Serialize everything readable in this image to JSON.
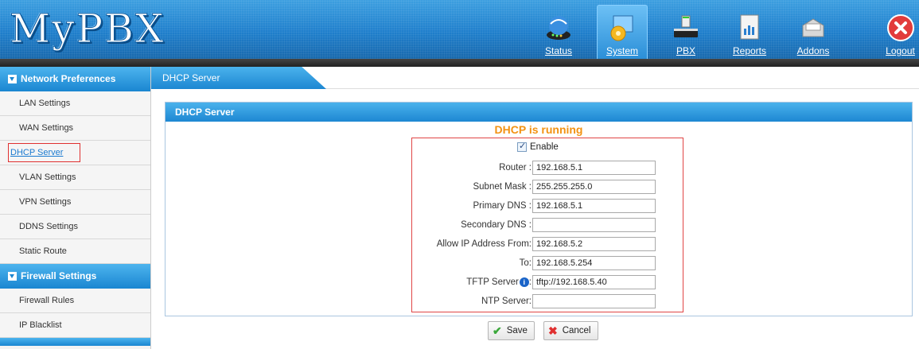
{
  "header": {
    "logo": "MyPBX",
    "nav": [
      {
        "label": "Status",
        "icon": "status-icon"
      },
      {
        "label": "System",
        "icon": "system-icon",
        "active": true
      },
      {
        "label": "PBX",
        "icon": "pbx-icon"
      },
      {
        "label": "Reports",
        "icon": "reports-icon"
      },
      {
        "label": "Addons",
        "icon": "addons-icon"
      }
    ],
    "logout_label": "Logout"
  },
  "sidebar": {
    "sections": [
      {
        "title": "Network Preferences",
        "items": [
          "LAN Settings",
          "WAN Settings",
          "DHCP Server",
          "VLAN Settings",
          "VPN Settings",
          "DDNS Settings",
          "Static Route"
        ]
      },
      {
        "title": "Firewall Settings",
        "items": [
          "Firewall Rules",
          "IP Blacklist"
        ]
      }
    ],
    "selected": "DHCP Server"
  },
  "tab": {
    "label": "DHCP Server"
  },
  "panel": {
    "title": "DHCP Server",
    "status": "DHCP is running",
    "enable_label": "Enable",
    "enabled": true,
    "fields": {
      "router": {
        "label": "Router :",
        "value": "192.168.5.1"
      },
      "subnet_mask": {
        "label": "Subnet Mask :",
        "value": "255.255.255.0"
      },
      "primary_dns": {
        "label": "Primary DNS :",
        "value": "192.168.5.1"
      },
      "secondary_dns": {
        "label": "Secondary DNS :",
        "value": ""
      },
      "allow_from": {
        "label": "Allow IP Address From:",
        "value": "192.168.5.2"
      },
      "to": {
        "label": "To:",
        "value": "192.168.5.254"
      },
      "tftp_server": {
        "label": "TFTP Server",
        "label_suffix": ":",
        "value": "tftp://192.168.5.40"
      },
      "ntp_server": {
        "label": "NTP Server:",
        "value": ""
      }
    }
  },
  "buttons": {
    "save": "Save",
    "cancel": "Cancel"
  }
}
